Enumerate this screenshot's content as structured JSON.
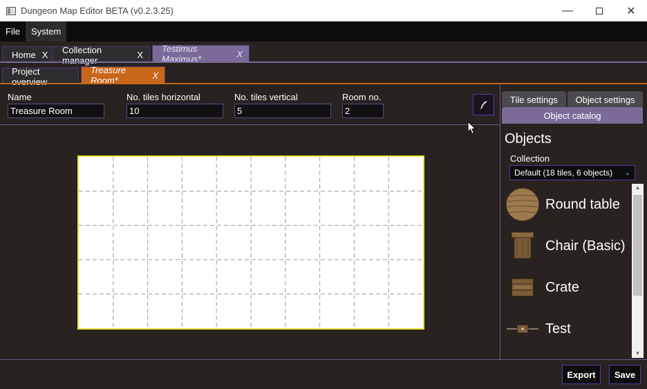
{
  "window": {
    "title": "Dungeon Map Editor BETA (v0.2.3.25)",
    "minimize_glyph": "—",
    "close_glyph": "✕"
  },
  "menu": {
    "items": [
      {
        "label": "File"
      },
      {
        "label": "System"
      }
    ]
  },
  "main_tabs": [
    {
      "label": "Home",
      "close": "X"
    },
    {
      "label": "Collection manager",
      "close": "X"
    },
    {
      "label": "Testimus Maximus*",
      "close": "X",
      "selected": true
    }
  ],
  "sub_tabs": [
    {
      "label": "Project overview"
    },
    {
      "label": "Treasure Room*",
      "close": "X",
      "selected": true
    }
  ],
  "room": {
    "name_label": "Name",
    "name_value": "Treasure Room",
    "tiles_h_label": "No. tiles horizontal",
    "tiles_h_value": "10",
    "tiles_v_label": "No. tiles vertical",
    "tiles_v_value": "5",
    "room_no_label": "Room no.",
    "room_no_value": "2"
  },
  "grid": {
    "columns": 10,
    "rows": 5,
    "border_color": "#e8e43a"
  },
  "right_panel": {
    "tabs": [
      {
        "label": "Tile settings"
      },
      {
        "label": "Object settings"
      },
      {
        "label": "Object catalog",
        "selected": true
      }
    ],
    "title": "Objects",
    "collection_label": "Collection",
    "collection_value": "Default (18 tiles, 6 objects)",
    "objects": [
      {
        "label": "Round table",
        "icon": "round-table-icon"
      },
      {
        "label": "Chair (Basic)",
        "icon": "chair-icon"
      },
      {
        "label": "Crate",
        "icon": "crate-icon"
      },
      {
        "label": "Test",
        "icon": "test-object-icon"
      }
    ]
  },
  "actions": {
    "export_label": "Export",
    "save_label": "Save"
  },
  "colors": {
    "accent_purple": "#7a6b9a",
    "accent_orange": "#c8661a",
    "border_purple": "#5b3aa0",
    "background": "#282220"
  }
}
